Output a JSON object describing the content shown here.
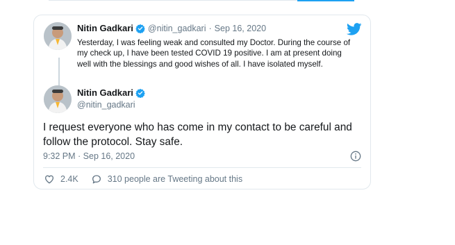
{
  "quoted_tweet": {
    "author_name": "Nitin Gadkari",
    "handle": "@nitin_gadkari",
    "separator": "·",
    "date": "Sep 16, 2020",
    "text": "Yesterday, I was feeling weak and consulted my Doctor. During the course of my check up, I have been tested COVID 19 positive. I am at present doing well with the blessings and good wishes of all. I have isolated myself."
  },
  "tweet": {
    "author_name": "Nitin Gadkari",
    "handle": "@nitin_gadkari",
    "text": "I request everyone who has come in my contact to be careful and follow the protocol. Stay safe.",
    "timestamp": "9:32 PM · Sep 16, 2020",
    "likes": "2.4K",
    "conversation": "310 people are Tweeting about this"
  },
  "colors": {
    "twitter_blue": "#1da1f2",
    "secondary_text": "#657786",
    "border": "#e1e8ed"
  },
  "icons": [
    "twitter-bird-icon",
    "verified-badge-icon",
    "info-icon",
    "heart-icon",
    "comment-icon"
  ]
}
